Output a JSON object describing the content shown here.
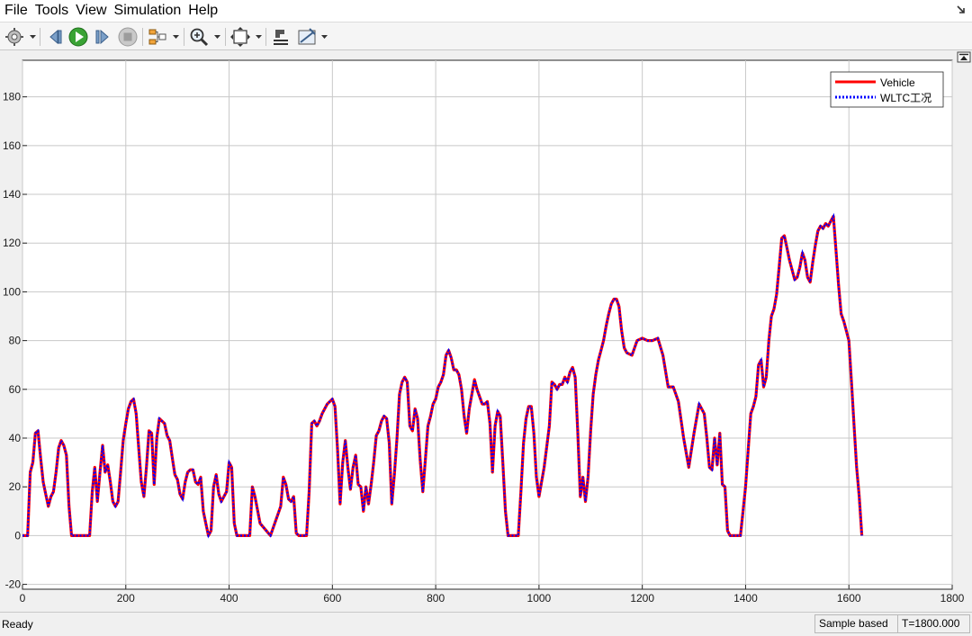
{
  "menu": {
    "file": "File",
    "tools": "Tools",
    "view": "View",
    "simulation": "Simulation",
    "help": "Help"
  },
  "toolbar": {
    "icons": [
      "settings-icon",
      "step-back-icon",
      "run-icon",
      "step-forward-icon",
      "stop-icon",
      "signal-selector-icon",
      "zoom-icon",
      "autoscale-icon",
      "style-icon",
      "measurement-icon"
    ]
  },
  "colors": {
    "vehicle": "#ff0000",
    "wltc": "#0000ff",
    "grid": "#c8c8c8",
    "axes_background": "#ffffff"
  },
  "chart_data": {
    "type": "line",
    "title": "",
    "xlabel": "",
    "ylabel": "",
    "xlim": [
      0,
      1800
    ],
    "ylim": [
      -22,
      195
    ],
    "x_ticks": [
      0,
      200,
      400,
      600,
      800,
      1000,
      1200,
      1400,
      1600,
      1800
    ],
    "y_ticks": [
      -20,
      0,
      20,
      40,
      60,
      80,
      100,
      120,
      140,
      160,
      180
    ],
    "grid": true,
    "legend_position": "top-right",
    "series": [
      {
        "name": "Vehicle",
        "style": "solid",
        "color": "#ff0000"
      },
      {
        "name": "WLTC工况",
        "style": "dotted",
        "color": "#0000ff"
      }
    ],
    "x": [
      0,
      10,
      15,
      20,
      25,
      30,
      35,
      40,
      45,
      50,
      55,
      60,
      65,
      70,
      75,
      80,
      85,
      90,
      95,
      100,
      110,
      120,
      130,
      135,
      140,
      145,
      150,
      155,
      160,
      165,
      170,
      175,
      180,
      185,
      190,
      195,
      200,
      205,
      210,
      215,
      220,
      225,
      230,
      235,
      240,
      245,
      250,
      255,
      260,
      265,
      270,
      275,
      280,
      285,
      290,
      295,
      300,
      305,
      310,
      315,
      320,
      325,
      330,
      335,
      340,
      345,
      350,
      355,
      360,
      365,
      370,
      375,
      380,
      385,
      390,
      395,
      400,
      405,
      410,
      415,
      420,
      425,
      430,
      435,
      440,
      445,
      450,
      460,
      480,
      500,
      505,
      510,
      515,
      520,
      525,
      530,
      535,
      540,
      545,
      550,
      555,
      560,
      565,
      570,
      575,
      580,
      590,
      600,
      605,
      610,
      615,
      620,
      625,
      630,
      635,
      640,
      645,
      650,
      655,
      660,
      665,
      670,
      675,
      680,
      685,
      690,
      695,
      700,
      705,
      710,
      715,
      720,
      725,
      730,
      735,
      740,
      745,
      750,
      755,
      760,
      765,
      770,
      775,
      780,
      785,
      790,
      795,
      800,
      805,
      810,
      815,
      820,
      825,
      830,
      835,
      840,
      845,
      850,
      855,
      860,
      865,
      870,
      875,
      880,
      885,
      890,
      895,
      900,
      905,
      910,
      915,
      920,
      925,
      930,
      935,
      940,
      945,
      950,
      955,
      960,
      965,
      970,
      975,
      980,
      985,
      990,
      995,
      1000,
      1010,
      1020,
      1025,
      1030,
      1035,
      1040,
      1045,
      1050,
      1055,
      1060,
      1065,
      1070,
      1075,
      1080,
      1085,
      1090,
      1095,
      1100,
      1105,
      1110,
      1115,
      1120,
      1125,
      1130,
      1135,
      1140,
      1145,
      1150,
      1155,
      1160,
      1165,
      1170,
      1180,
      1190,
      1200,
      1210,
      1220,
      1230,
      1240,
      1250,
      1260,
      1270,
      1280,
      1290,
      1300,
      1310,
      1320,
      1325,
      1330,
      1335,
      1340,
      1345,
      1350,
      1355,
      1360,
      1365,
      1370,
      1375,
      1380,
      1385,
      1390,
      1395,
      1400,
      1405,
      1410,
      1415,
      1420,
      1425,
      1430,
      1435,
      1440,
      1445,
      1450,
      1455,
      1460,
      1465,
      1470,
      1475,
      1480,
      1485,
      1490,
      1495,
      1500,
      1505,
      1510,
      1515,
      1520,
      1525,
      1530,
      1535,
      1540,
      1545,
      1550,
      1555,
      1560,
      1565,
      1570,
      1575,
      1580,
      1585,
      1590,
      1595,
      1600,
      1605,
      1610,
      1615,
      1620,
      1625,
      1630,
      1635,
      1640,
      1645,
      1650,
      1655,
      1660,
      1670,
      1680,
      1690,
      1700,
      1710,
      1720,
      1725,
      1730,
      1735,
      1740,
      1745,
      1750,
      1755,
      1760,
      1765,
      1770,
      1775,
      1780,
      1785,
      1790,
      1795,
      1800
    ],
    "vehicle": [
      0,
      0,
      26,
      30,
      42,
      43,
      32,
      22,
      17,
      12,
      16,
      18,
      26,
      36,
      39,
      37,
      33,
      12,
      0,
      0,
      0,
      0,
      0,
      18,
      28,
      14,
      26,
      37,
      26,
      29,
      22,
      14,
      12,
      14,
      26,
      39,
      46,
      52,
      55,
      56,
      50,
      36,
      22,
      16,
      28,
      43,
      42,
      21,
      40,
      48,
      47,
      46,
      41,
      39,
      32,
      25,
      23,
      17,
      15,
      22,
      26,
      27,
      27,
      22,
      21,
      24,
      10,
      5,
      0,
      2,
      20,
      25,
      17,
      14,
      16,
      18,
      30,
      28,
      5,
      0,
      0,
      0,
      0,
      0,
      0,
      20,
      16,
      5,
      0,
      12,
      24,
      21,
      15,
      14,
      16,
      1,
      0,
      0,
      0,
      0,
      18,
      46,
      47,
      45,
      47,
      50,
      54,
      56,
      53,
      35,
      13,
      30,
      39,
      28,
      19,
      28,
      33,
      21,
      20,
      10,
      20,
      13,
      21,
      30,
      41,
      43,
      47,
      49,
      48,
      38,
      13,
      25,
      40,
      58,
      63,
      65,
      63,
      45,
      43,
      52,
      48,
      31,
      18,
      31,
      45,
      49,
      54,
      56,
      61,
      63,
      66,
      74,
      76,
      73,
      68,
      68,
      66,
      60,
      49,
      42,
      52,
      58,
      64,
      60,
      57,
      54,
      54,
      55,
      46,
      26,
      45,
      51,
      49,
      30,
      10,
      0,
      0,
      0,
      0,
      0,
      18,
      38,
      48,
      53,
      53,
      42,
      24,
      16,
      28,
      45,
      63,
      62,
      60,
      62,
      62,
      65,
      63,
      67,
      69,
      65,
      43,
      16,
      24,
      14,
      24,
      43,
      58,
      66,
      72,
      76,
      80,
      86,
      91,
      95,
      97,
      97,
      94,
      84,
      77,
      75,
      74,
      80,
      81,
      80,
      80,
      81,
      74,
      61,
      61,
      55,
      40,
      28,
      42,
      54,
      50,
      40,
      28,
      27,
      40,
      29,
      42,
      21,
      20,
      2,
      0,
      0,
      0,
      0,
      0,
      10,
      20,
      35,
      50,
      53,
      57,
      70,
      72,
      61,
      65,
      80,
      90,
      93,
      99,
      110,
      122,
      123,
      118,
      113,
      109,
      105,
      106,
      110,
      116,
      113,
      106,
      104,
      112,
      119,
      125,
      127,
      126,
      128,
      127,
      129,
      131,
      117,
      103,
      91,
      88,
      84,
      80,
      63,
      45,
      28,
      16,
      0
    ],
    "wltc": [
      0,
      0,
      26,
      30,
      42,
      43,
      32,
      22,
      17,
      12,
      16,
      18,
      26,
      36,
      39,
      37,
      33,
      12,
      0,
      0,
      0,
      0,
      0,
      18,
      28,
      14,
      26,
      37,
      26,
      29,
      22,
      14,
      12,
      14,
      26,
      39,
      46,
      52,
      55,
      56,
      50,
      36,
      22,
      16,
      28,
      43,
      42,
      21,
      40,
      48,
      47,
      46,
      41,
      39,
      32,
      25,
      23,
      17,
      15,
      22,
      26,
      27,
      27,
      22,
      21,
      24,
      10,
      5,
      0,
      2,
      20,
      25,
      17,
      14,
      16,
      18,
      30,
      28,
      5,
      0,
      0,
      0,
      0,
      0,
      0,
      20,
      16,
      5,
      0,
      12,
      24,
      21,
      15,
      14,
      16,
      1,
      0,
      0,
      0,
      0,
      18,
      46,
      47,
      45,
      47,
      50,
      54,
      56,
      53,
      35,
      13,
      30,
      39,
      28,
      19,
      28,
      33,
      21,
      20,
      10,
      20,
      13,
      21,
      30,
      41,
      43,
      47,
      49,
      48,
      38,
      13,
      25,
      40,
      58,
      63,
      65,
      63,
      45,
      43,
      52,
      48,
      31,
      18,
      31,
      45,
      49,
      54,
      56,
      61,
      63,
      66,
      74,
      76,
      73,
      68,
      68,
      66,
      60,
      49,
      42,
      52,
      58,
      64,
      60,
      57,
      54,
      54,
      55,
      46,
      26,
      45,
      51,
      49,
      30,
      10,
      0,
      0,
      0,
      0,
      0,
      18,
      38,
      48,
      53,
      53,
      42,
      24,
      16,
      28,
      45,
      63,
      62,
      60,
      62,
      62,
      65,
      63,
      67,
      69,
      65,
      43,
      16,
      24,
      14,
      24,
      43,
      58,
      66,
      72,
      76,
      80,
      86,
      91,
      95,
      97,
      97,
      94,
      84,
      77,
      75,
      74,
      80,
      81,
      80,
      80,
      81,
      74,
      61,
      61,
      55,
      40,
      28,
      42,
      54,
      50,
      40,
      28,
      27,
      40,
      29,
      42,
      21,
      20,
      2,
      0,
      0,
      0,
      0,
      0,
      10,
      20,
      35,
      50,
      53,
      57,
      70,
      72,
      61,
      65,
      80,
      90,
      93,
      99,
      110,
      122,
      123,
      118,
      113,
      109,
      105,
      106,
      110,
      116,
      113,
      106,
      104,
      112,
      119,
      125,
      127,
      126,
      128,
      127,
      129,
      131,
      117,
      103,
      91,
      88,
      84,
      80,
      63,
      45,
      28,
      16,
      0
    ]
  },
  "status": {
    "text": "Ready",
    "mode": "Sample based",
    "time": "T=1800.000"
  }
}
